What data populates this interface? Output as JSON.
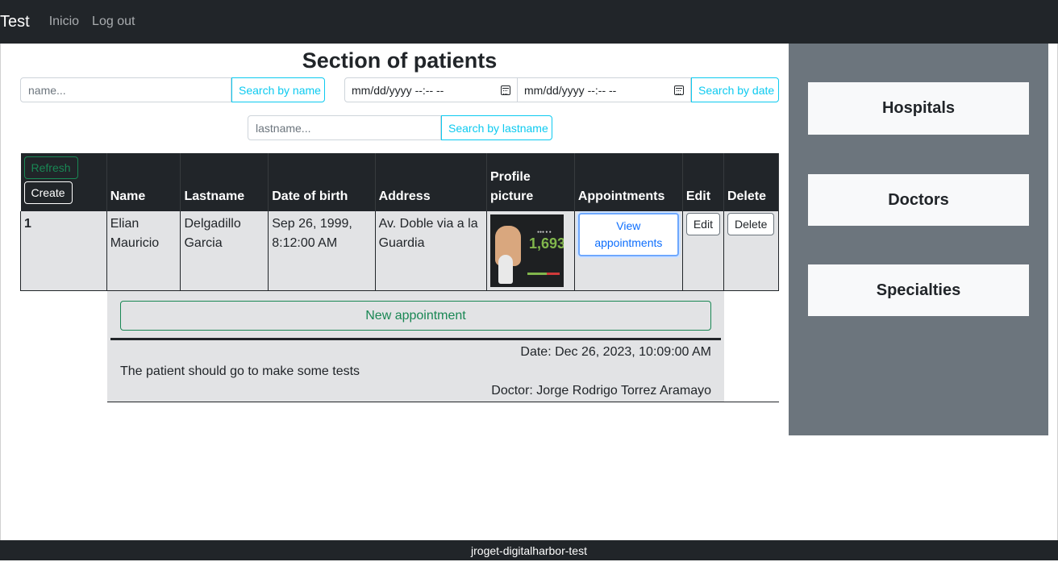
{
  "navbar": {
    "brand": "Test",
    "links": [
      "Inicio",
      "Log out"
    ]
  },
  "main": {
    "title": "Section of patients",
    "search_name": {
      "placeholder": "name...",
      "button": "Search by name"
    },
    "search_date": {
      "from_placeholder": "mm/dd/yyyy --:-- --",
      "to_placeholder": "mm/dd/yyyy --:-- --",
      "button": "Search by date"
    },
    "search_lastname": {
      "placeholder": "lastname...",
      "button": "Search by lastname"
    }
  },
  "table": {
    "refresh_label": "Refresh",
    "create_label": "Create",
    "headers": [
      "Name",
      "Lastname",
      "Date of birth",
      "Address",
      "Profile picture",
      "Appointments",
      "Edit",
      "Delete"
    ],
    "rows": [
      {
        "id": "1",
        "name": "Elian Mauricio",
        "lastname": "Delgadillo Garcia",
        "dob": "Sep 26, 1999, 8:12:00 AM",
        "address": "Av. Doble via a la Guardia",
        "picture_icon": "chess-profile-image",
        "appointments_label": "View appointments",
        "edit_label": "Edit",
        "delete_label": "Delete"
      }
    ]
  },
  "appointments": {
    "new_label": "New appointment",
    "items": [
      {
        "date": "Date: Dec 26, 2023, 10:09:00 AM",
        "description": "The patient should go to make some tests",
        "doctor": "Doctor: Jorge Rodrigo Torrez Aramayo"
      }
    ]
  },
  "sidebar": {
    "items": [
      "Hospitals",
      "Doctors",
      "Specialties"
    ]
  },
  "footer": {
    "text": "jroget-digitalharbor-test"
  },
  "colors": {
    "navbar": "#212529",
    "sidebar": "#6c757d",
    "info": "#0dcaf0",
    "success": "#198754",
    "primary": "#0d6efd",
    "row_bg": "#e2e3e5"
  }
}
